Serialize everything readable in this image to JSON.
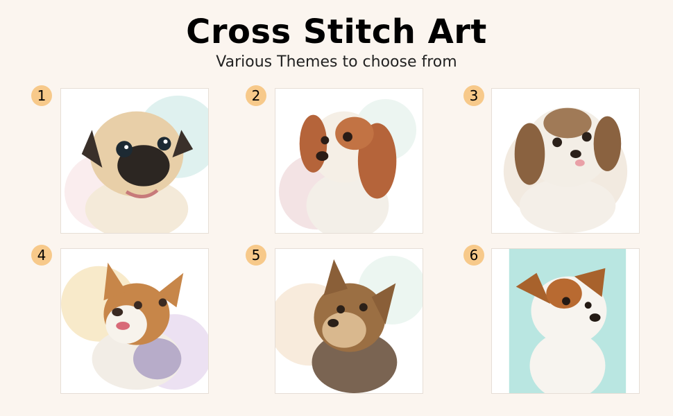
{
  "header": {
    "title": "Cross Stitch Art",
    "subtitle": "Various Themes to choose from"
  },
  "themes": [
    {
      "number": "1",
      "icon": "pug-puppy-portrait",
      "accent": "#b8e0dc",
      "fur": "#e8cfa8",
      "dark": "#2c2622"
    },
    {
      "number": "2",
      "icon": "cavalier-puppy-portrait",
      "accent": "#e8c7c9",
      "fur": "#b5643a",
      "dark": "#2a1c16"
    },
    {
      "number": "3",
      "icon": "shih-tzu-puppy-portrait",
      "accent": "#e9dccb",
      "fur": "#8a6240",
      "dark": "#2b211a"
    },
    {
      "number": "4",
      "icon": "corgi-puppy-portrait",
      "accent": "#f3dca6",
      "fur": "#c78649",
      "dark": "#3a2a22"
    },
    {
      "number": "5",
      "icon": "yorkie-puppy-portrait",
      "accent": "#f4ddc4",
      "fur": "#9b6f43",
      "dark": "#2b2018"
    },
    {
      "number": "6",
      "icon": "jack-russell-puppy-portrait",
      "accent": "#7fd1c8",
      "fur": "#a8622c",
      "dark": "#231a14"
    }
  ]
}
